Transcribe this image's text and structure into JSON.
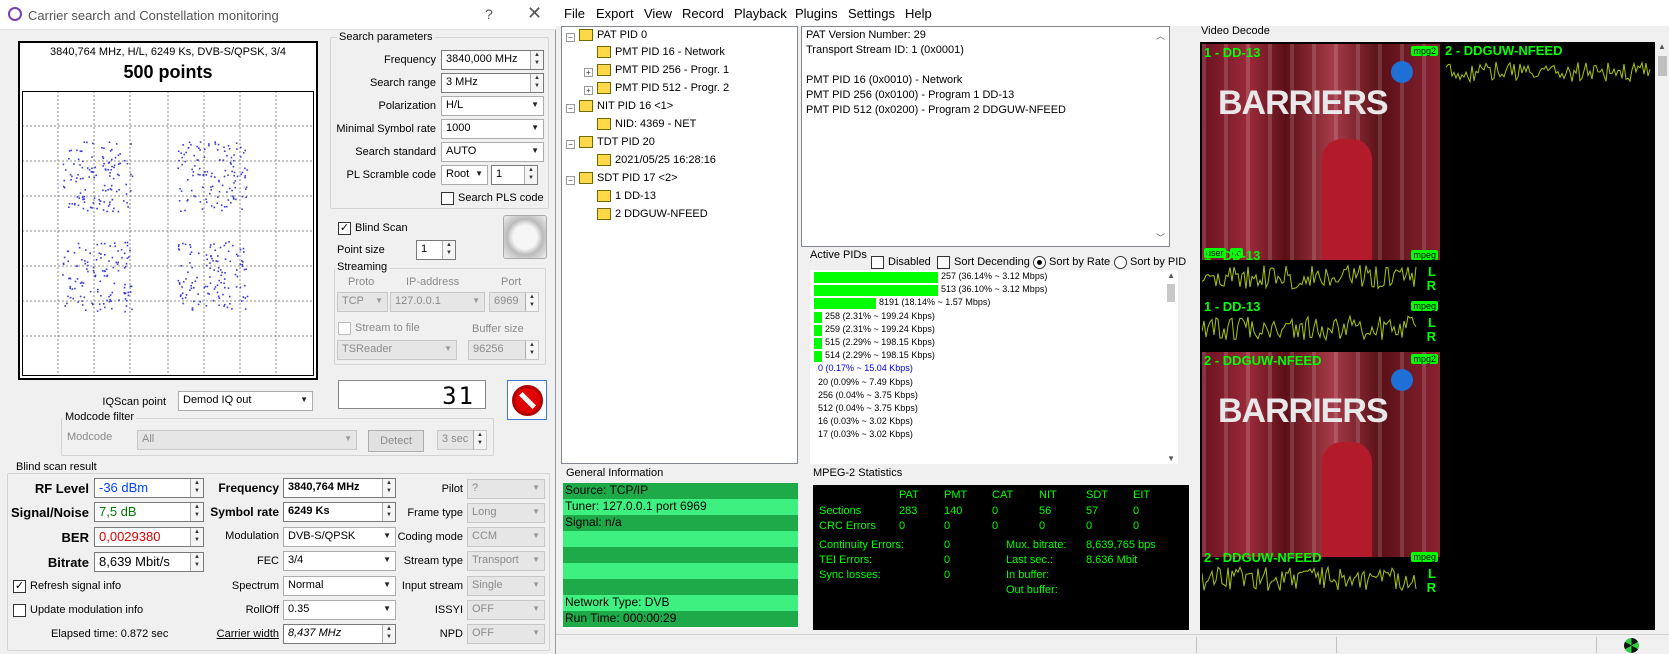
{
  "left_window": {
    "title": "Carrier search and Constellation monitoring",
    "help_button": "?",
    "constellation": {
      "info": "3840,764 MHz, H/L, 6249 Ks, DVB-S/QPSK, 3/4",
      "points": "500 points"
    },
    "search_params": {
      "group_label": "Search parameters",
      "frequency_label": "Frequency",
      "frequency_value": "3840,000 MHz",
      "range_label": "Search range",
      "range_value": "3 MHz",
      "polarization_label": "Polarization",
      "polarization_value": "H/L",
      "min_sr_label": "Minimal Symbol rate",
      "min_sr_value": "1000",
      "standard_label": "Search standard",
      "standard_value": "AUTO",
      "pls_label": "PL Scramble code",
      "pls_mode": "Root",
      "pls_value": "1",
      "search_pls_label": "Search PLS code"
    },
    "blind_scan_label": "Blind Scan",
    "point_size_label": "Point size",
    "point_size_value": "1",
    "streaming": {
      "label": "Streaming",
      "proto_label": "Proto",
      "ip_label": "IP-address",
      "port_label": "Port",
      "proto_value": "TCP",
      "ip_value": "127.0.0.1",
      "port_value": "6969",
      "stream_to_file_label": "Stream to file",
      "buffer_label": "Buffer size",
      "reader_value": "TSReader",
      "buffer_value": "96256"
    },
    "iqscan_label": "IQScan point",
    "iqscan_value": "Demod IQ out",
    "display_value": "31",
    "modcode": {
      "group_label": "Modcode filter",
      "label": "Modcode",
      "value": "All",
      "detect_label": "Detect",
      "timeout_value": "3 sec"
    },
    "result": {
      "group_label": "Blind scan result",
      "rf_label": "RF Level",
      "rf_value": "-36 dBm",
      "sn_label": "Signal/Noise",
      "sn_value": "7,5 dB",
      "ber_label": "BER",
      "ber_value": "0,0029380",
      "bitrate_label": "Bitrate",
      "bitrate_value": "8,639 Mbit/s",
      "freq_label": "Frequency",
      "freq_value": "3840,764 MHz",
      "sr_label": "Symbol rate",
      "sr_value": "6249 Ks",
      "modulation_label": "Modulation",
      "modulation_value": "DVB-S/QPSK",
      "fec_label": "FEC",
      "fec_value": "3/4",
      "spectrum_label": "Spectrum",
      "spectrum_value": "Normal",
      "rolloff_label": "RollOff",
      "rolloff_value": "0.35",
      "carrier_width_label": "Carrier width",
      "carrier_width_value": "8,437 MHz",
      "pilot_label": "Pilot",
      "pilot_value": "?",
      "frame_label": "Frame type",
      "frame_value": "Long",
      "coding_label": "Coding mode",
      "coding_value": "CCM",
      "stream_type_label": "Stream type",
      "stream_type_value": "Transport",
      "input_stream_label": "Input stream",
      "input_stream_value": "Single",
      "issyi_label": "ISSYI",
      "issyi_value": "OFF",
      "npd_label": "NPD",
      "npd_value": "OFF"
    },
    "refresh_label": "Refresh signal info",
    "update_mod_label": "Update modulation info",
    "elapsed": "Elapsed time: 0.872 sec"
  },
  "menu": [
    "File",
    "Export",
    "View",
    "Record",
    "Playback",
    "Plugins",
    "Settings",
    "Help"
  ],
  "tree": [
    {
      "text": "PAT PID 0"
    },
    {
      "text": "PMT PID 16 - Network"
    },
    {
      "text": "PMT PID 256 - Progr. 1"
    },
    {
      "text": "PMT PID 512 - Progr. 2"
    },
    {
      "text": "NIT PID 16 <1>"
    },
    {
      "text": "NID: 4369 - NET"
    },
    {
      "text": "TDT PID 20"
    },
    {
      "text": "2021/05/25 16:28:16"
    },
    {
      "text": "SDT PID 17 <2>"
    },
    {
      "text": "1 DD-13"
    },
    {
      "text": "2 DDGUW-NFEED"
    }
  ],
  "info_lines": [
    "PAT Version Number: 29",
    "Transport Stream ID: 1 (0x0001)",
    "",
    "PMT PID 16 (0x0010) - Network",
    "PMT PID 256 (0x0100) - Program 1 DD-13",
    "PMT PID 512 (0x0200) - Program 2 DDGUW-NFEED"
  ],
  "active_pids": {
    "label": "Active PIDs",
    "disabled_label": "Disabled",
    "sort_desc_label": "Sort Decending",
    "sort_rate_label": "Sort by Rate",
    "sort_pid_label": "Sort by PID",
    "rows": [
      {
        "text": "257 (36.14% ~ 3.12 Mbps)",
        "pct": 36.14
      },
      {
        "text": "513 (36.10% ~ 3.12 Mbps)",
        "pct": 36.1
      },
      {
        "text": "8191 (18.14% ~ 1.57 Mbps)",
        "pct": 18.14
      },
      {
        "text": "258 (2.31% ~ 199.24 Kbps)",
        "pct": 2.31
      },
      {
        "text": "259 (2.31% ~ 199.24 Kbps)",
        "pct": 2.31
      },
      {
        "text": "515 (2.29% ~ 198.15 Kbps)",
        "pct": 2.29
      },
      {
        "text": "514 (2.29% ~ 198.15 Kbps)",
        "pct": 2.29
      },
      {
        "text": "0 (0.17% ~ 15.04 Kbps)",
        "pct": 0.17
      },
      {
        "text": "20 (0.09% ~ 7.49 Kbps)",
        "pct": 0.09
      },
      {
        "text": "256 (0.04% ~ 3.75 Kbps)",
        "pct": 0.04
      },
      {
        "text": "512 (0.04% ~ 3.75 Kbps)",
        "pct": 0.04
      },
      {
        "text": "16 (0.03% ~ 3.02 Kbps)",
        "pct": 0.03
      },
      {
        "text": "17 (0.03% ~ 3.02 Kbps)",
        "pct": 0.03
      }
    ]
  },
  "general_info": {
    "label": "General Information",
    "lines": [
      "Source: TCP/IP",
      "Tuner: 127.0.0.1 port 6969",
      "Signal: n/a",
      "",
      "",
      "",
      "",
      "Network Type: DVB",
      "Run Time: 000:00:29"
    ]
  },
  "mpeg_stats": {
    "label": "MPEG-2 Statistics",
    "headers": [
      "PAT",
      "PMT",
      "CAT",
      "NIT",
      "SDT",
      "EIT"
    ],
    "sections_label": "Sections",
    "sections": [
      "283",
      "140",
      "0",
      "56",
      "57",
      "0"
    ],
    "crc_label": "CRC Errors",
    "crc": [
      "0",
      "0",
      "0",
      "0",
      "0",
      "0"
    ],
    "continuity_label": "Continuity Errors:",
    "continuity_value": "0",
    "tei_label": "TEI Errors:",
    "tei_value": "0",
    "sync_label": "Sync losses:",
    "sync_value": "0",
    "mux_label": "Mux. bitrate:",
    "mux_value": "8,639,765 bps",
    "last_label": "Last sec.:",
    "last_value": "8.636 Mbit",
    "inbuf_label": "In buffer:",
    "outbuf_label": "Out buffer:"
  },
  "video": {
    "label": "Video Decode",
    "ch1": "1 - DD-13",
    "ch2": "2 - DDGUW-NFEED",
    "a1": "1 - DD-13",
    "a2": "1 - DD-13",
    "v2": "2 - DDGUW-NFEED",
    "a3": "2 - DDGUW-NFEED",
    "mpg2": "mpg2",
    "mpeg": "mpeg",
    "user": "user",
    "cc": "cc",
    "l": "L",
    "r": "R",
    "banner": "BARRIERS"
  }
}
